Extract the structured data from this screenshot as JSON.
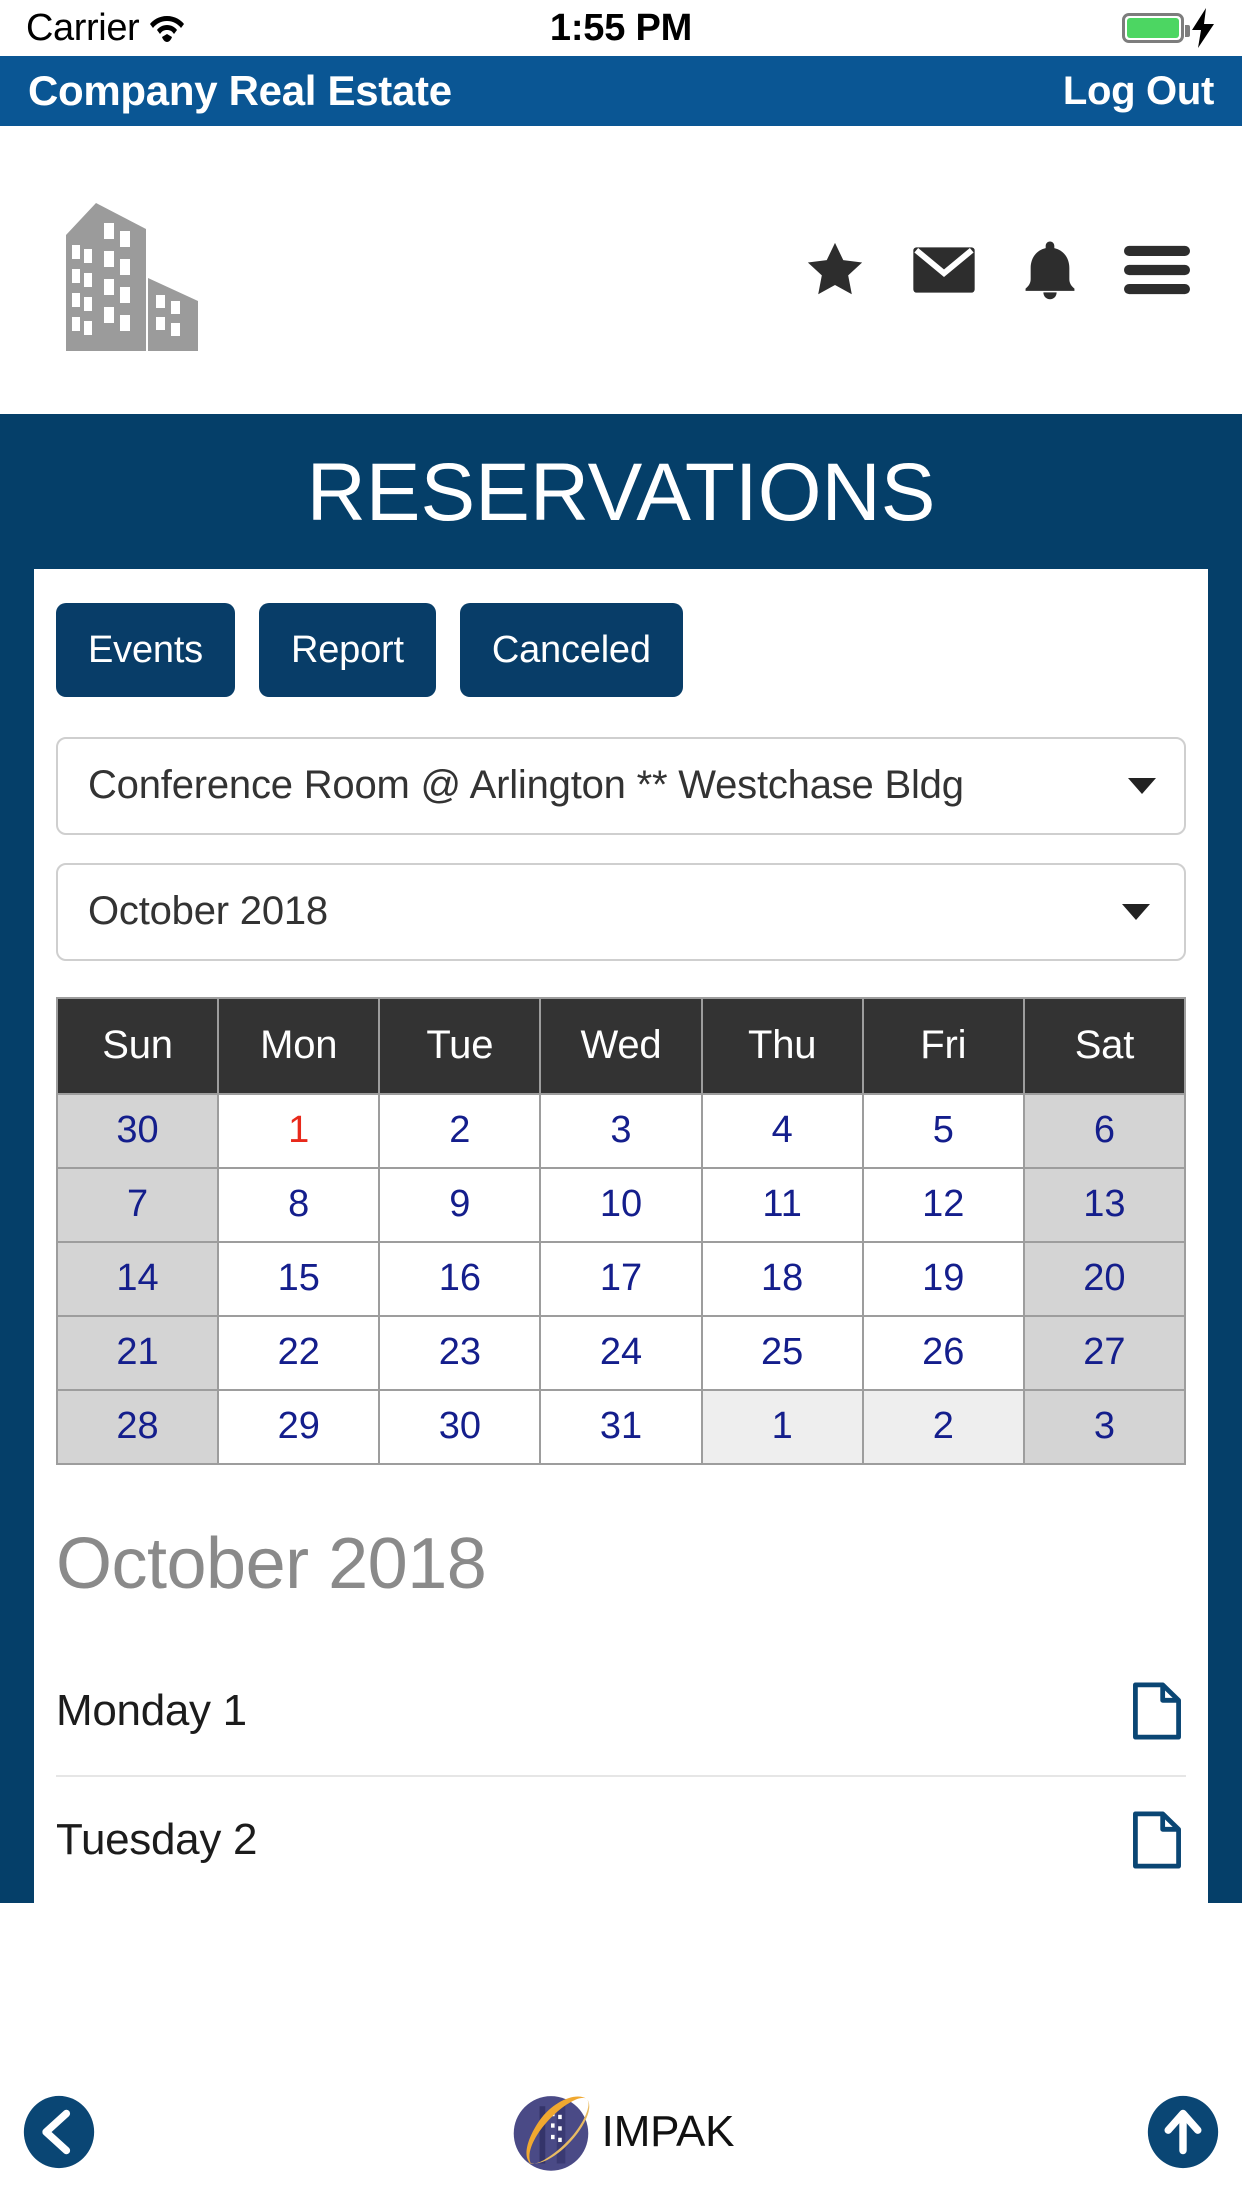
{
  "status_bar": {
    "carrier": "Carrier",
    "time": "1:55 PM",
    "wifi_icon": "wifi-icon",
    "battery_icon": "battery-icon",
    "charging_icon": "lightning-bolt-icon"
  },
  "nav": {
    "title": "Company Real Estate",
    "logout_label": "Log Out"
  },
  "header_icons": {
    "logo_icon": "office-building-logo",
    "items": [
      {
        "name": "star-icon",
        "label": "Favorites"
      },
      {
        "name": "envelope-icon",
        "label": "Messages"
      },
      {
        "name": "bell-icon",
        "label": "Notifications"
      },
      {
        "name": "hamburger-menu-icon",
        "label": "Menu"
      }
    ]
  },
  "hero": {
    "title": "RESERVATIONS"
  },
  "tabs": [
    {
      "label": "Events"
    },
    {
      "label": "Report"
    },
    {
      "label": "Canceled"
    }
  ],
  "room_select": {
    "value": "Conference Room @ Arlington ** Westchase Bldg",
    "caret_icon": "chevron-down-icon"
  },
  "month_select": {
    "value": "October 2018",
    "caret_icon": "chevron-down-icon"
  },
  "calendar": {
    "weekday_headers": [
      "Sun",
      "Mon",
      "Tue",
      "Wed",
      "Thu",
      "Fri",
      "Sat"
    ],
    "weeks": [
      [
        {
          "day": "30",
          "weekend": true,
          "out_of_month": false,
          "today": false
        },
        {
          "day": "1",
          "weekend": false,
          "out_of_month": false,
          "today": true
        },
        {
          "day": "2",
          "weekend": false,
          "out_of_month": false,
          "today": false
        },
        {
          "day": "3",
          "weekend": false,
          "out_of_month": false,
          "today": false
        },
        {
          "day": "4",
          "weekend": false,
          "out_of_month": false,
          "today": false
        },
        {
          "day": "5",
          "weekend": false,
          "out_of_month": false,
          "today": false
        },
        {
          "day": "6",
          "weekend": true,
          "out_of_month": false,
          "today": false
        }
      ],
      [
        {
          "day": "7",
          "weekend": true,
          "out_of_month": false,
          "today": false
        },
        {
          "day": "8",
          "weekend": false,
          "out_of_month": false,
          "today": false
        },
        {
          "day": "9",
          "weekend": false,
          "out_of_month": false,
          "today": false
        },
        {
          "day": "10",
          "weekend": false,
          "out_of_month": false,
          "today": false
        },
        {
          "day": "11",
          "weekend": false,
          "out_of_month": false,
          "today": false
        },
        {
          "day": "12",
          "weekend": false,
          "out_of_month": false,
          "today": false
        },
        {
          "day": "13",
          "weekend": true,
          "out_of_month": false,
          "today": false
        }
      ],
      [
        {
          "day": "14",
          "weekend": true,
          "out_of_month": false,
          "today": false
        },
        {
          "day": "15",
          "weekend": false,
          "out_of_month": false,
          "today": false
        },
        {
          "day": "16",
          "weekend": false,
          "out_of_month": false,
          "today": false
        },
        {
          "day": "17",
          "weekend": false,
          "out_of_month": false,
          "today": false
        },
        {
          "day": "18",
          "weekend": false,
          "out_of_month": false,
          "today": false
        },
        {
          "day": "19",
          "weekend": false,
          "out_of_month": false,
          "today": false
        },
        {
          "day": "20",
          "weekend": true,
          "out_of_month": false,
          "today": false
        }
      ],
      [
        {
          "day": "21",
          "weekend": true,
          "out_of_month": false,
          "today": false
        },
        {
          "day": "22",
          "weekend": false,
          "out_of_month": false,
          "today": false
        },
        {
          "day": "23",
          "weekend": false,
          "out_of_month": false,
          "today": false
        },
        {
          "day": "24",
          "weekend": false,
          "out_of_month": false,
          "today": false
        },
        {
          "day": "25",
          "weekend": false,
          "out_of_month": false,
          "today": false
        },
        {
          "day": "26",
          "weekend": false,
          "out_of_month": false,
          "today": false
        },
        {
          "day": "27",
          "weekend": true,
          "out_of_month": false,
          "today": false
        }
      ],
      [
        {
          "day": "28",
          "weekend": true,
          "out_of_month": false,
          "today": false
        },
        {
          "day": "29",
          "weekend": false,
          "out_of_month": false,
          "today": false
        },
        {
          "day": "30",
          "weekend": false,
          "out_of_month": false,
          "today": false
        },
        {
          "day": "31",
          "weekend": false,
          "out_of_month": false,
          "today": false
        },
        {
          "day": "1",
          "weekend": false,
          "out_of_month": true,
          "today": false
        },
        {
          "day": "2",
          "weekend": false,
          "out_of_month": true,
          "today": false
        },
        {
          "day": "3",
          "weekend": true,
          "out_of_month": true,
          "today": false
        }
      ]
    ]
  },
  "month_heading": "October 2018",
  "events": [
    {
      "label": "Monday 1",
      "icon": "document-icon"
    },
    {
      "label": "Tuesday 2",
      "icon": "document-icon"
    }
  ],
  "toolbar": {
    "back_icon": "back-arrow-icon",
    "brand_label": "IMPAK",
    "brand_logo_icon": "impak-globe-logo",
    "up_icon": "up-arrow-icon"
  },
  "colors": {
    "nav_blue": "#0a5694",
    "hero_navy": "#053f69",
    "button_navy": "#083d68",
    "calendar_header": "#333333",
    "day_text": "#141e8c",
    "today_red": "#e8291b",
    "weekend_bg": "#d4d4d4",
    "out_of_month_bg": "#eeeeee",
    "accent_navy": "#0a4674"
  }
}
